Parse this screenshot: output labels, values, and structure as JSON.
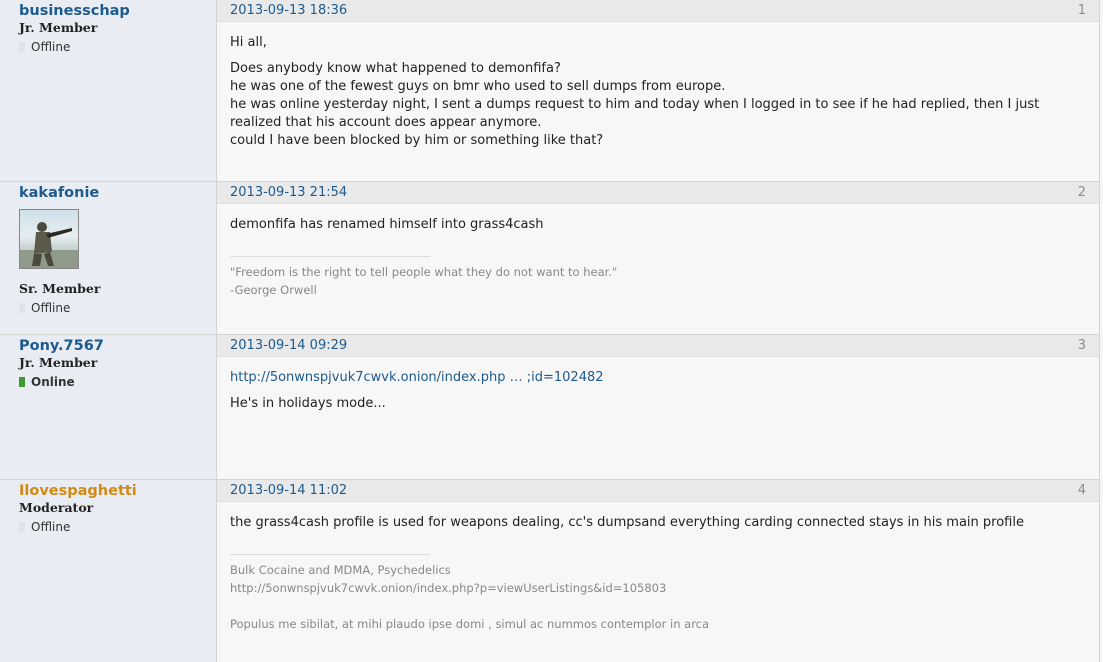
{
  "posts": [
    {
      "author": "businesschap",
      "role": "Jr. Member",
      "status": "Offline",
      "date": "2013-09-13 18:36",
      "number": "1",
      "body": [
        "Hi all,",
        "Does anybody know what happened to demonfifa?",
        "he was one of the fewest guys on bmr who used to sell dumps from europe.",
        "he was online yesterday night, I sent a dumps request to him and today when I logged in to see if he had replied, then  I just realized that his account does appear anymore.",
        "could I have been blocked by him or something like that?"
      ]
    },
    {
      "author": "kakafonie",
      "role": "Sr. Member",
      "status": "Offline",
      "date": "2013-09-13 21:54",
      "number": "2",
      "body": [
        "demonfifa has renamed himself into grass4cash"
      ],
      "signature": [
        "\"Freedom is the right to tell people what they do not want to hear.\"",
        "-George Orwell"
      ]
    },
    {
      "author": "Pony.7567",
      "role": "Jr. Member",
      "status": "Online",
      "date": "2013-09-14 09:29",
      "number": "3",
      "link": "http://5onwnspjvuk7cwvk.onion/index.php … ;id=102482",
      "body": [
        "He's in holidays mode..."
      ]
    },
    {
      "author": "Ilovespaghetti",
      "role": "Moderator",
      "status": "Offline",
      "date": "2013-09-14 11:02",
      "number": "4",
      "body": [
        "the grass4cash profile is used for weapons dealing, cc's dumpsand everything carding connected stays in his main profile"
      ],
      "signature": [
        "Bulk Cocaine and MDMA, Psychedelics",
        "http://5onwnspjvuk7cwvk.onion/index.php?p=viewUserListings&id=105803",
        "",
        "Populus me sibilat, at mihi plaudo ipse domi , simul ac nummos contemplor in arca"
      ]
    }
  ]
}
